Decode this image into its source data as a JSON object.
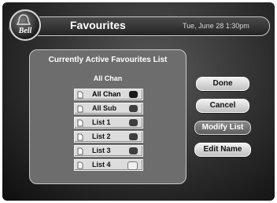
{
  "header": {
    "logo_text": "Bell",
    "title": "Favourites",
    "datetime": "Tue, June 28 1:30pm"
  },
  "panel": {
    "title": "Currently Active Favourites List",
    "active_list": "All Chan",
    "items": [
      {
        "label": "All Chan",
        "icon": "page-icon",
        "status_icon": "square-badge-icon",
        "selected": true
      },
      {
        "label": "All Sub",
        "icon": "page-icon",
        "status_icon": "square-badge-icon"
      },
      {
        "label": "List 1",
        "icon": "page-icon",
        "status_icon": "square-badge-icon"
      },
      {
        "label": "List 2",
        "icon": "page-icon",
        "status_icon": "square-badge-icon"
      },
      {
        "label": "List 3",
        "icon": "page-icon",
        "status_icon": "square-badge-icon"
      },
      {
        "label": "List 4",
        "icon": "page-icon",
        "status_icon": "square-badge-icon"
      }
    ]
  },
  "buttons": {
    "done": "Done",
    "cancel": "Cancel",
    "modify_list": "Modify List",
    "edit_name": "Edit Name",
    "highlighted": "modify_list"
  }
}
